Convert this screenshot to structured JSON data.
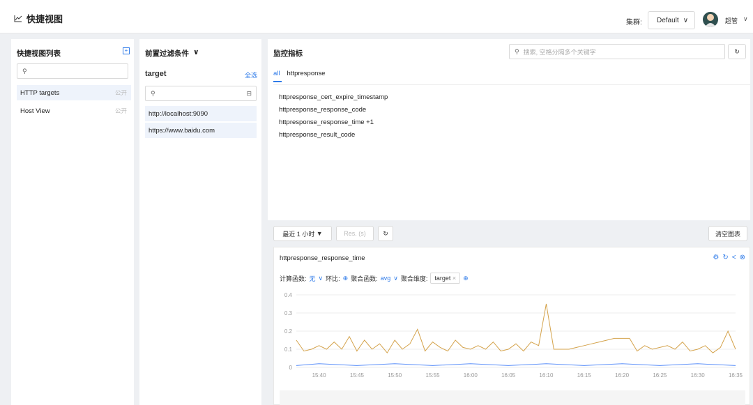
{
  "header": {
    "title": "快捷视图",
    "cluster_label": "集群:",
    "cluster_value": "Default",
    "user": "超管"
  },
  "left": {
    "title": "快捷视图列表",
    "items": [
      {
        "label": "HTTP targets",
        "tag": "公开"
      },
      {
        "label": "Host View",
        "tag": "公开"
      }
    ]
  },
  "filters": {
    "title": "前置过滤条件",
    "target_label": "target",
    "select_all": "全选",
    "targets": [
      "http://localhost:9090",
      "https://www.baidu.com"
    ]
  },
  "metrics": {
    "title": "监控指标",
    "search_placeholder": "搜索, 空格分隔多个关键字",
    "tabs": [
      "all",
      "httpresponse"
    ],
    "items": [
      "httpresponse_cert_expire_timestamp",
      "httpresponse_response_code",
      "httpresponse_response_time +1",
      "httpresponse_result_code"
    ]
  },
  "toolbar": {
    "time_range": "最近 1 小时",
    "res": "Res. (s)",
    "clear": "清空图表"
  },
  "panel": {
    "title": "httpresponse_response_time",
    "calc_label": "计算函数:",
    "calc_value": "无",
    "ratio_label": "环比:",
    "agg_label": "聚合函数:",
    "agg_value": "avg",
    "dim_label": "聚合维度:",
    "dim_value": "target"
  },
  "chart_data": {
    "type": "line",
    "y_ticks": [
      "0",
      "0.1",
      "0.2",
      "0.3",
      "0.4"
    ],
    "x_ticks": [
      "15:40",
      "15:45",
      "15:50",
      "15:55",
      "16:00",
      "16:05",
      "16:10",
      "16:15",
      "16:20",
      "16:25",
      "16:30",
      "16:35"
    ],
    "ylim": [
      0,
      0.4
    ],
    "series": [
      {
        "color": "#d4a24a",
        "x": [
          "15:37",
          "15:38",
          "15:39",
          "15:40",
          "15:41",
          "15:42",
          "15:43",
          "15:44",
          "15:45",
          "15:46",
          "15:47",
          "15:48",
          "15:49",
          "15:50",
          "15:51",
          "15:52",
          "15:53",
          "15:54",
          "15:55",
          "15:56",
          "15:57",
          "15:58",
          "15:59",
          "16:00",
          "16:01",
          "16:02",
          "16:03",
          "16:04",
          "16:05",
          "16:06",
          "16:07",
          "16:08",
          "16:09",
          "16:10",
          "16:11",
          "16:12",
          "16:13",
          "16:14",
          "16:15",
          "16:16",
          "16:17",
          "16:18",
          "16:19",
          "16:20",
          "16:21",
          "16:22",
          "16:23",
          "16:24",
          "16:25",
          "16:26",
          "16:27",
          "16:28",
          "16:29",
          "16:30",
          "16:31",
          "16:32",
          "16:33",
          "16:34",
          "16:35"
        ],
        "values": [
          0.15,
          0.09,
          0.1,
          0.12,
          0.1,
          0.14,
          0.1,
          0.17,
          0.09,
          0.15,
          0.1,
          0.13,
          0.08,
          0.15,
          0.1,
          0.13,
          0.21,
          0.09,
          0.14,
          0.11,
          0.09,
          0.15,
          0.11,
          0.1,
          0.12,
          0.1,
          0.14,
          0.09,
          0.1,
          0.13,
          0.09,
          0.14,
          0.12,
          0.35,
          0.1,
          0.1,
          0.1,
          0.11,
          0.12,
          0.13,
          0.14,
          0.15,
          0.16,
          0.16,
          0.16,
          0.09,
          0.12,
          0.1,
          0.11,
          0.12,
          0.1,
          0.14,
          0.09,
          0.1,
          0.12,
          0.08,
          0.11,
          0.2,
          0.1
        ]
      },
      {
        "color": "#5b8ff9",
        "x": [
          "15:37",
          "15:40",
          "15:45",
          "15:50",
          "15:55",
          "16:00",
          "16:05",
          "16:10",
          "16:15",
          "16:20",
          "16:25",
          "16:30",
          "16:35"
        ],
        "values": [
          0.01,
          0.02,
          0.01,
          0.02,
          0.01,
          0.02,
          0.01,
          0.02,
          0.01,
          0.02,
          0.01,
          0.02,
          0.01
        ]
      }
    ]
  }
}
